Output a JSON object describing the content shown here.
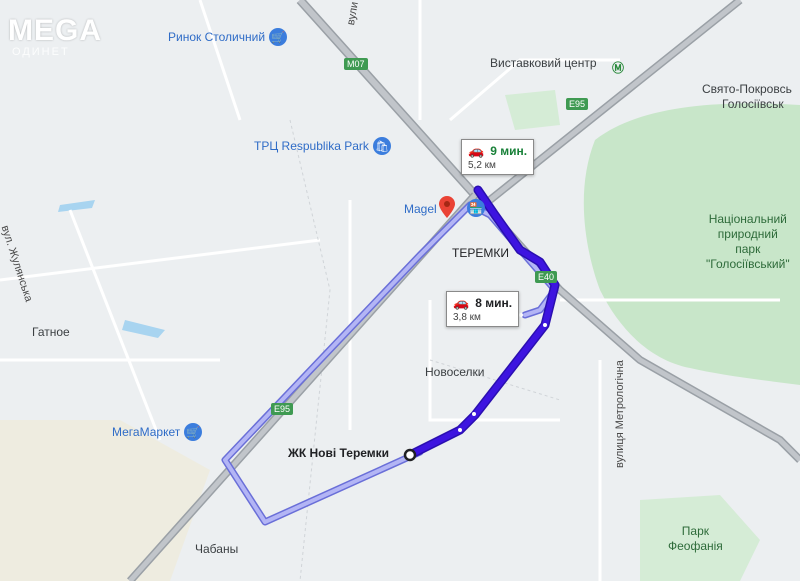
{
  "watermark": {
    "brand": "MEGA",
    "sub": "ОДИНЕТ"
  },
  "pois": [
    {
      "name": "Ринок Столичний",
      "icon": "shopping-cart-icon",
      "glyph": "🛒"
    },
    {
      "name": "ТРЦ Respublika Park",
      "icon": "shopping-bag-icon",
      "glyph": "🛍"
    },
    {
      "name": "МегаМаркет",
      "icon": "shopping-cart-icon",
      "glyph": "🛒"
    },
    {
      "name": "Magel",
      "icon": "store-icon",
      "glyph": "🏪"
    }
  ],
  "places": {
    "vystavkovyi": "Виставковий центр",
    "svyato_pokrovskyi_1": "Свято-Покровсь",
    "svyato_pokrovskyi_2": "Голосіївськ",
    "teremky": "ТЕРЕМКИ",
    "novoselky": "Новоселки",
    "gatnoe": "Гатное",
    "chabany": "Чабаны",
    "destination": "ЖК Нові Теремки"
  },
  "parks": {
    "holosiivskyi": [
      "Національний",
      "природний",
      "парк",
      "\"Голосіївський\""
    ],
    "feofaniya": [
      "Парк",
      "Феофанія"
    ]
  },
  "roads": {
    "zhulianska": "вул. Жулянська",
    "metrolohichna": "вулиця Метрологічна",
    "vul_top": "вули"
  },
  "road_shields": [
    "M07",
    "E95",
    "E40",
    "E95"
  ],
  "routes": [
    {
      "time": "9 мин.",
      "distance": "5,2 км",
      "selected": false
    },
    {
      "time": "8 мин.",
      "distance": "3,8 км",
      "selected": true
    }
  ],
  "colors": {
    "map_bg": "#eceff1",
    "park": "#c8e6c9",
    "route_selected": "#3d14e0",
    "route_alt": "#b3b5f5",
    "poi_blue": "#3b7ddd",
    "fast_time": "#188038"
  }
}
